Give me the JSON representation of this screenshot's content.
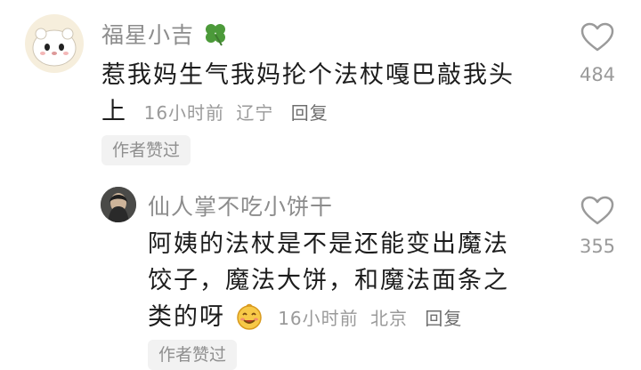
{
  "comments": [
    {
      "username": "福星小吉",
      "text_line1": "惹我妈生气我妈抡个法杖嘎巴敲我头",
      "text_line2": "上",
      "time": "16小时前",
      "location": "辽宁",
      "reply_label": "回复",
      "badge": "作者赞过",
      "like_count": "484",
      "name_emoji": "four-leaf-clover"
    },
    {
      "username": "仙人掌不吃小饼干",
      "text_line1": "阿姨的法杖是不是还能变出魔法",
      "text_line2": "饺子，魔法大饼，和魔法面条之",
      "text_line3": "类的呀",
      "time": "16小时前",
      "location": "北京",
      "reply_label": "回复",
      "badge": "作者赞过",
      "like_count": "355",
      "inline_emoji": "smiling-face"
    }
  ]
}
